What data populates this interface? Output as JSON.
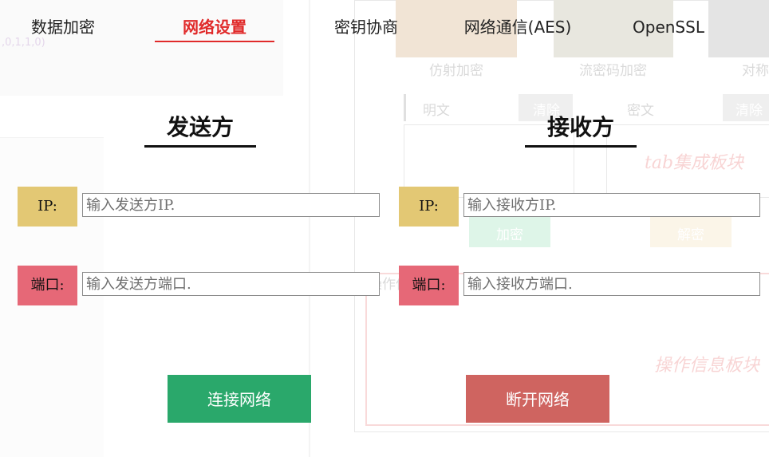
{
  "tabs": [
    {
      "label": "数据加密",
      "active": false
    },
    {
      "label": "网络设置",
      "active": true
    },
    {
      "label": "密钥协商",
      "active": false
    },
    {
      "label": "网络通信(AES)",
      "active": false
    },
    {
      "label": "OpenSSL",
      "active": false
    }
  ],
  "sender": {
    "title": "发送方",
    "ip_label": "IP:",
    "ip_placeholder": "输入发送方IP.",
    "port_label": "端口:",
    "port_placeholder": "输入发送方端口."
  },
  "receiver": {
    "title": "接收方",
    "ip_label": "IP:",
    "ip_placeholder": "输入接收方IP.",
    "port_label": "端口:",
    "port_placeholder": "输入接收方端口."
  },
  "actions": {
    "connect_label": "连接网络",
    "disconnect_label": "断开网络"
  },
  "colors": {
    "accent": "#e02a2a",
    "ip_label_bg": "#e3c874",
    "port_label_bg": "#e66877",
    "connect_bg": "#2aa86b",
    "disconnect_bg": "#cf6460"
  },
  "background_ghost": {
    "code_snippet": ",0,1,1,0)",
    "cards": [
      "仿射加密",
      "流密码加密",
      "对称"
    ],
    "plaintext_label": "明文",
    "ciphertext_label": "密文",
    "clear_label": "清除",
    "encrypt_label": "加密",
    "decrypt_label": "解密",
    "tab_block_text": "tab集成板块",
    "op_info_label": "操作信息",
    "op_block_text": "操作信息板块"
  }
}
